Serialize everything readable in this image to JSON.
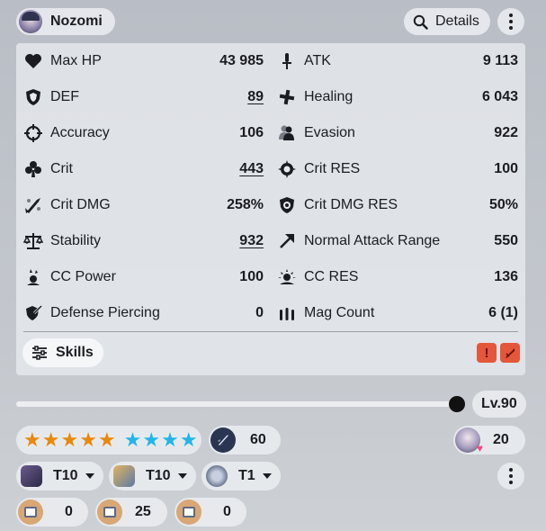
{
  "character": {
    "name": "Nozomi"
  },
  "header": {
    "details_label": "Details"
  },
  "stats": [
    {
      "label": "Max HP",
      "value": "43 985",
      "icon": "heart-icon",
      "underlined": false
    },
    {
      "label": "ATK",
      "value": "9 113",
      "icon": "atk-icon",
      "underlined": false
    },
    {
      "label": "DEF",
      "value": "89",
      "icon": "shield-icon",
      "underlined": true
    },
    {
      "label": "Healing",
      "value": "6 043",
      "icon": "cross-icon",
      "underlined": false
    },
    {
      "label": "Accuracy",
      "value": "106",
      "icon": "crosshair-icon",
      "underlined": false
    },
    {
      "label": "Evasion",
      "value": "922",
      "icon": "evasion-icon",
      "underlined": false
    },
    {
      "label": "Crit",
      "value": "443",
      "icon": "club-icon",
      "underlined": true
    },
    {
      "label": "Crit RES",
      "value": "100",
      "icon": "crit-res-icon",
      "underlined": false
    },
    {
      "label": "Crit DMG",
      "value": "258%",
      "icon": "crit-dmg-icon",
      "underlined": false
    },
    {
      "label": "Crit DMG RES",
      "value": "50%",
      "icon": "crit-dmg-res-icon",
      "underlined": false
    },
    {
      "label": "Stability",
      "value": "932",
      "icon": "scale-icon",
      "underlined": true
    },
    {
      "label": "Normal Attack Range",
      "value": "550",
      "icon": "arrow-icon",
      "underlined": false
    },
    {
      "label": "CC Power",
      "value": "100",
      "icon": "cc-power-icon",
      "underlined": false
    },
    {
      "label": "CC RES",
      "value": "136",
      "icon": "cc-res-icon",
      "underlined": false
    },
    {
      "label": "Defense Piercing",
      "value": "0",
      "icon": "defense-piercing-icon",
      "underlined": false
    },
    {
      "label": "Mag Count",
      "value": "6 (1)",
      "icon": "mag-icon",
      "underlined": false
    }
  ],
  "skills": {
    "label": "Skills"
  },
  "level": {
    "label": "Lv.90",
    "fraction": 1.0
  },
  "stars": {
    "orange_count": 5,
    "blue_count": 4
  },
  "gear_count": "60",
  "bond_level": "20",
  "tiers": [
    {
      "label": "T10",
      "icon": "hat-equipment-icon"
    },
    {
      "label": "T10",
      "icon": "glove-equipment-icon"
    },
    {
      "label": "T1",
      "icon": "shoe-equipment-icon"
    }
  ],
  "items": [
    {
      "value": "0"
    },
    {
      "value": "25"
    },
    {
      "value": "0"
    }
  ],
  "colors": {
    "star_orange": "#e8890c",
    "star_blue": "#22b6e8",
    "warning": "#e4573a"
  }
}
